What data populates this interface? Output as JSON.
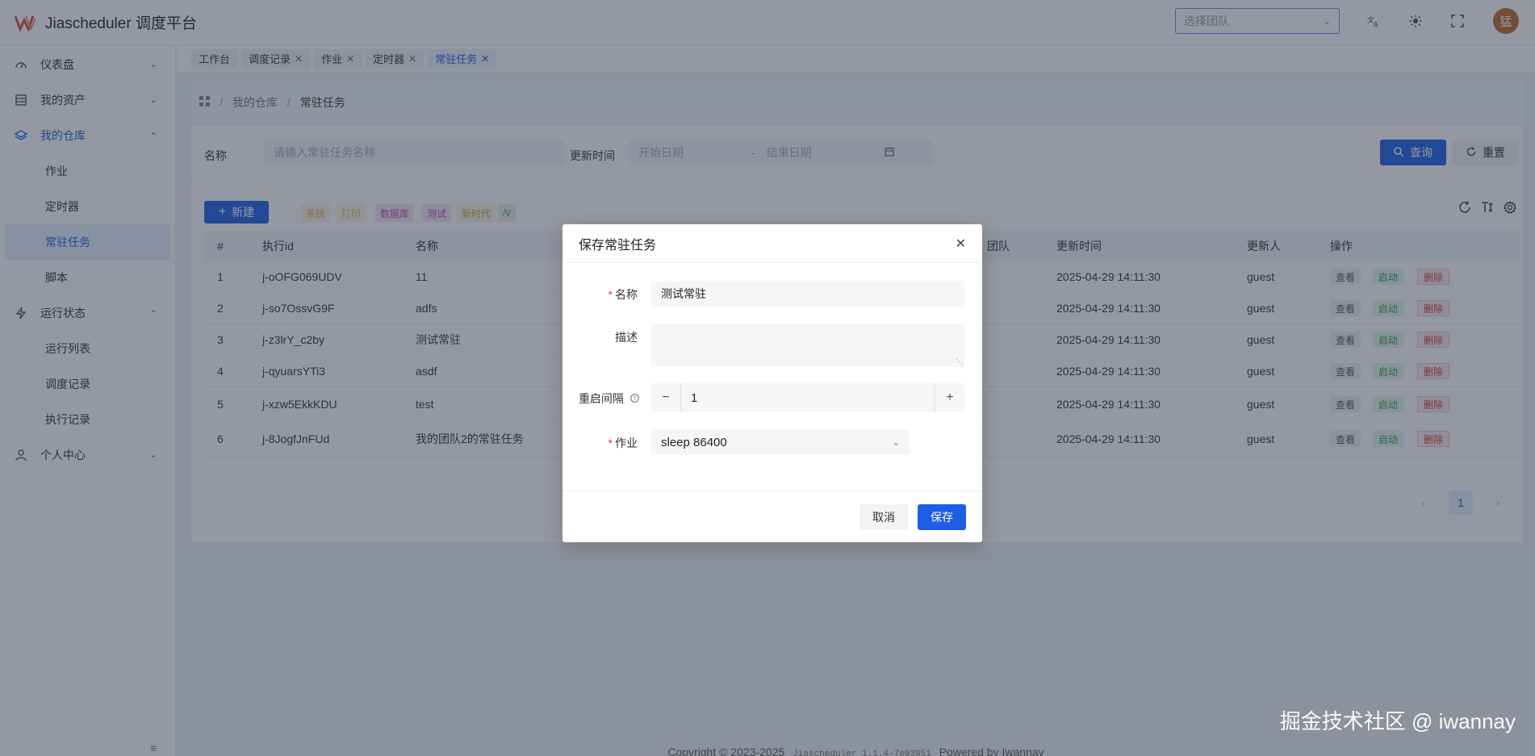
{
  "app": {
    "title": "Jiascheduler 调度平台"
  },
  "header": {
    "team_placeholder": "选择团队",
    "avatar_text": "猛"
  },
  "sidebar": {
    "items": [
      {
        "label": "仪表盘",
        "icon": "dashboard-icon",
        "expanded": false
      },
      {
        "label": "我的资产",
        "icon": "assets-icon",
        "expanded": false
      },
      {
        "label": "我的仓库",
        "icon": "layers-icon",
        "expanded": true,
        "children": [
          "作业",
          "定时器",
          "常驻任务",
          "脚本"
        ]
      },
      {
        "label": "运行状态",
        "icon": "bolt-icon",
        "expanded": true,
        "children": [
          "运行列表",
          "调度记录",
          "执行记录"
        ]
      },
      {
        "label": "个人中心",
        "icon": "user-icon",
        "expanded": false
      }
    ],
    "selected": "常驻任务"
  },
  "tabs": [
    {
      "label": "工作台",
      "closable": false
    },
    {
      "label": "调度记录",
      "closable": true
    },
    {
      "label": "作业",
      "closable": true
    },
    {
      "label": "定时器",
      "closable": true
    },
    {
      "label": "常驻任务",
      "closable": true,
      "active": true
    }
  ],
  "breadcrumb": {
    "root_icon": "grid-icon",
    "parent": "我的仓库",
    "current": "常驻任务"
  },
  "search": {
    "name_label": "名称",
    "name_placeholder": "请输入常驻任务名称",
    "time_label": "更新时间",
    "start_placeholder": "开始日期",
    "range_sep": "-",
    "end_placeholder": "结束日期",
    "query_label": "查询",
    "reset_label": "重置"
  },
  "toolbar": {
    "new_label": "新建",
    "tags": [
      {
        "label": "系统",
        "color": "#e8a64a"
      },
      {
        "label": "打印",
        "color": "#e0c14a"
      },
      {
        "label": "数据库",
        "color": "#c045a8"
      },
      {
        "label": "测试",
        "color": "#c045a8"
      },
      {
        "label": "新时代",
        "color": "#c9a42a"
      },
      {
        "label": "/\\/",
        "color": "#3a9a3a"
      }
    ]
  },
  "table": {
    "columns": [
      "#",
      "执行id",
      "名称",
      "团队",
      "更新时间",
      "更新人",
      "操作"
    ],
    "rows": [
      {
        "idx": "1",
        "id": "j-oOFG069UDV",
        "name": "11",
        "updated": "2025-04-29 14:11:30",
        "user": "guest"
      },
      {
        "idx": "2",
        "id": "j-so7OssvG9F",
        "name": "adfs",
        "updated": "2025-04-29 14:11:30",
        "user": "guest"
      },
      {
        "idx": "3",
        "id": "j-z3lrY_c2by",
        "name": "测试常驻",
        "updated": "2025-04-29 14:11:30",
        "user": "guest"
      },
      {
        "idx": "4",
        "id": "j-qyuarsYTi3",
        "name": "asdf",
        "updated": "2025-04-29 14:11:30",
        "user": "guest"
      },
      {
        "idx": "5",
        "id": "j-xzw5EkkKDU",
        "name": "test",
        "updated": "2025-04-29 14:11:30",
        "user": "guest"
      },
      {
        "idx": "6",
        "id": "j-8JogfJnFUd",
        "name": "我的团队2的常驻任务",
        "updated": "2025-04-29 14:11:30",
        "user": "guest"
      }
    ],
    "actions": {
      "view": "查看",
      "start": "启动",
      "delete": "删除"
    }
  },
  "pagination": {
    "current": "1"
  },
  "footer": {
    "copyright": "Copyright © 2023-2025",
    "version": "Jiascheduler 1.1.4-7e93951",
    "powered": "Powered by Iwannay"
  },
  "modal": {
    "title": "保存常驻任务",
    "name_label": "名称",
    "name_value": "测试常驻",
    "desc_label": "描述",
    "desc_value": "",
    "interval_label": "重启间隔",
    "interval_value": "1",
    "job_label": "作业",
    "job_value": "sleep 86400",
    "cancel_label": "取消",
    "save_label": "保存"
  },
  "watermark": "掘金技术社区 @ iwannay"
}
